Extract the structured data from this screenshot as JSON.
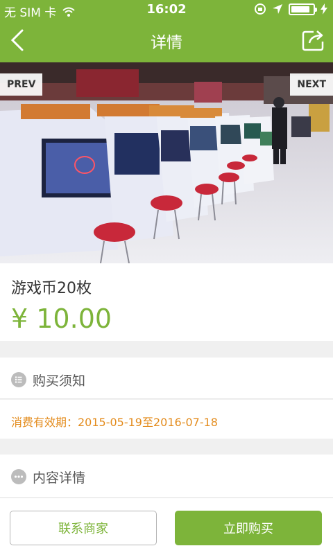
{
  "status_bar": {
    "carrier": "无 SIM 卡",
    "time": "16:02",
    "battery_level": 0.85
  },
  "nav": {
    "title": "详情",
    "back_icon": "chevron-left-icon",
    "share_icon": "share-icon"
  },
  "gallery": {
    "prev_label": "PREV",
    "next_label": "NEXT"
  },
  "product": {
    "title": "游戏币20枚",
    "price": "¥ 10.00"
  },
  "notice": {
    "heading": "购买须知",
    "validity": "消费有效期：2015-05-19至2016-07-18"
  },
  "details": {
    "heading": "内容详情"
  },
  "footer": {
    "contact_label": "联系商家",
    "buy_label": "立即购买"
  },
  "colors": {
    "brand_green": "#7db43a",
    "accent_orange": "#e38b1c"
  }
}
